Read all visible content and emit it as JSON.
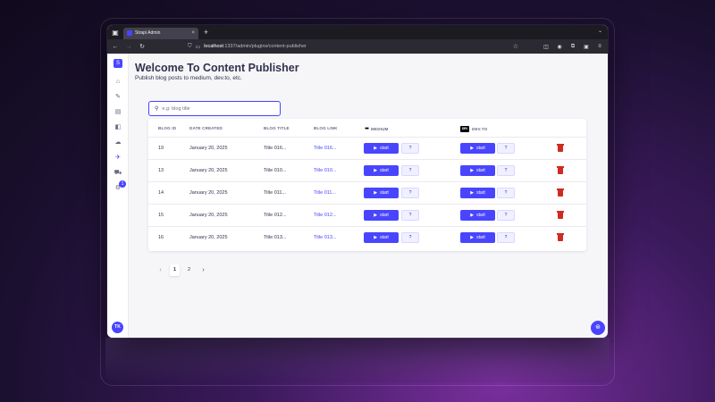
{
  "browser": {
    "tab_title": "Strapi Admin",
    "tab_close": "×",
    "new_tab": "+",
    "url_host": "localhost",
    "url_path": ":1337/admin/plugins/content-publisher"
  },
  "sidebar": {
    "logo": "S",
    "notification_count": "1",
    "user_initials": "TK"
  },
  "page": {
    "title": "Welcome To Content Publisher",
    "subtitle": "Publish blog posts to medium, dev.to, etc."
  },
  "search": {
    "placeholder": "e.g: blog title",
    "value": ""
  },
  "table": {
    "headers": {
      "blog_id": "BLOG ID",
      "date_created": "DATE CREATED",
      "blog_title": "BLOG TITLE",
      "blog_link": "BLOG LINK",
      "medium": "MEDIUM",
      "devto": "DEV.TO",
      "devto_logo": "DEV"
    },
    "start_label": "start",
    "help_label": "?",
    "rows": [
      {
        "id": "19",
        "date": "January 20, 2025",
        "title": "Title 016...",
        "link": "Title 016..."
      },
      {
        "id": "13",
        "date": "January 20, 2025",
        "title": "Title 010...",
        "link": "Title 010..."
      },
      {
        "id": "14",
        "date": "January 20, 2025",
        "title": "Title 011...",
        "link": "Title 011..."
      },
      {
        "id": "15",
        "date": "January 20, 2025",
        "title": "Title 012...",
        "link": "Title 012..."
      },
      {
        "id": "16",
        "date": "January 20, 2025",
        "title": "Title 013...",
        "link": "Title 013..."
      }
    ]
  },
  "pagination": {
    "pages": [
      "1",
      "2"
    ],
    "current": "1"
  },
  "colors": {
    "primary": "#4945ff",
    "danger": "#d02b20",
    "text": "#32324d"
  }
}
